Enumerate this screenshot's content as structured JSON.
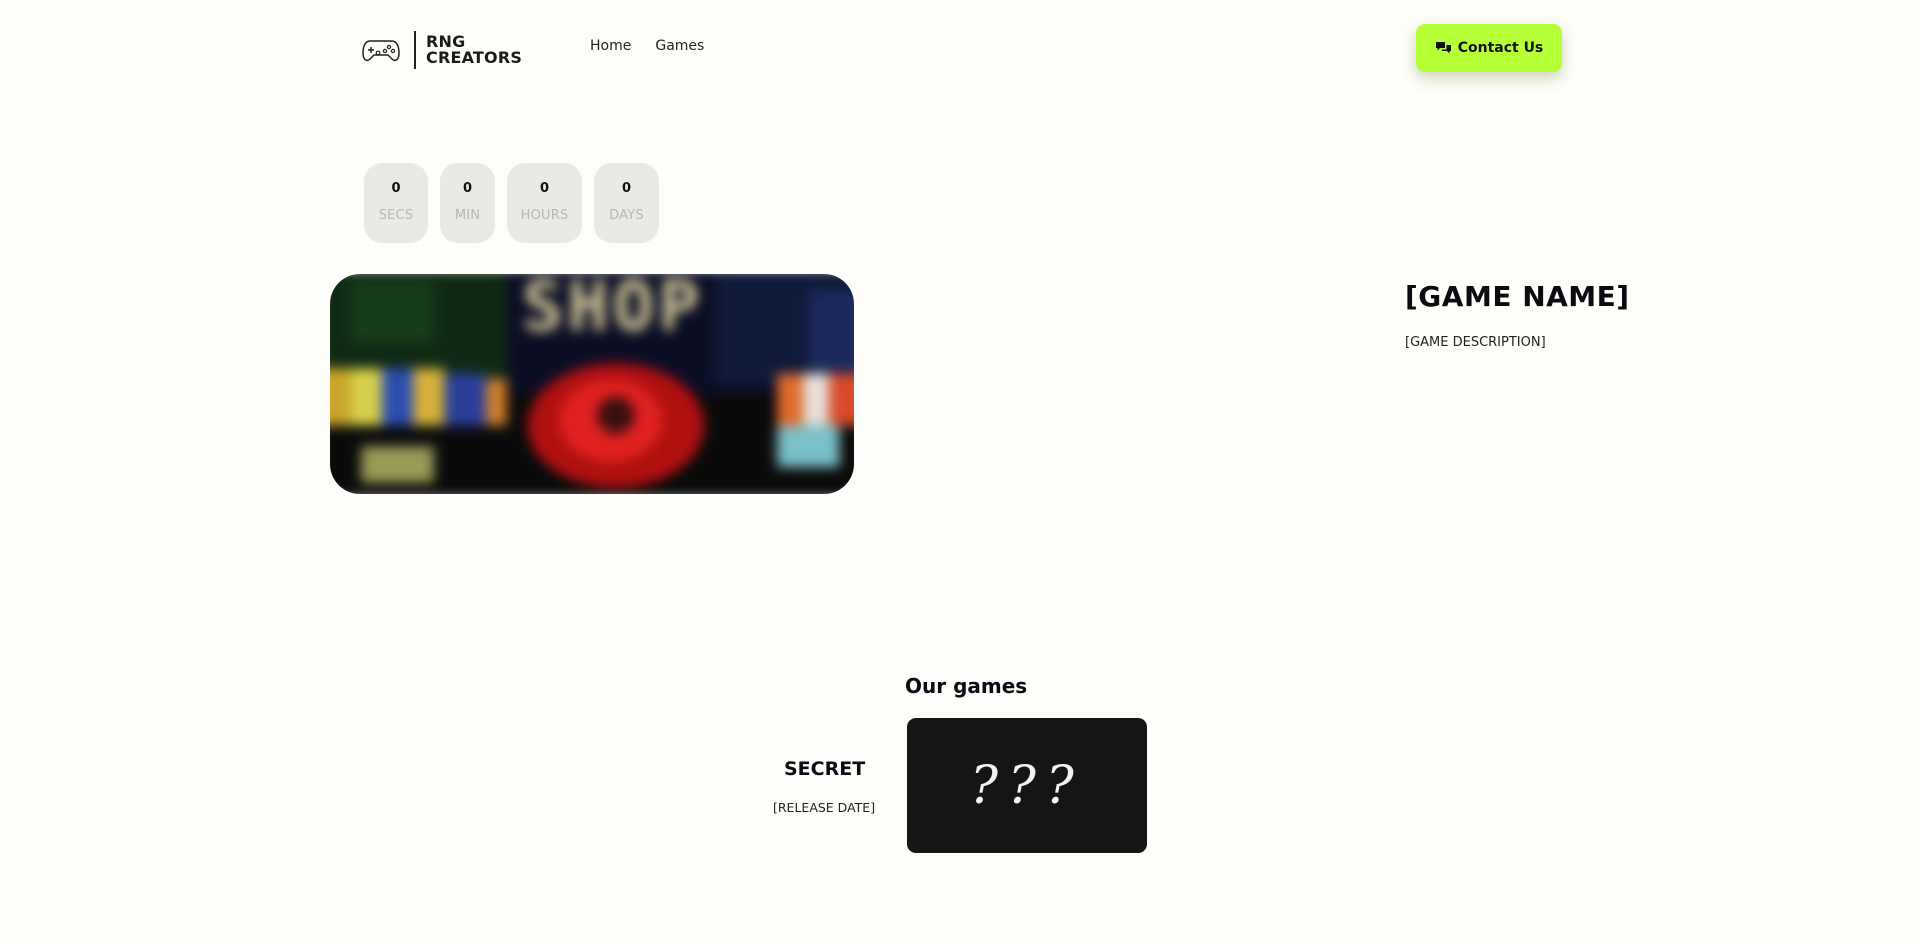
{
  "header": {
    "logo": {
      "line1": "RNG",
      "line2": "CREATORS",
      "icon": "gamepad-icon"
    },
    "nav": [
      {
        "label": "Home"
      },
      {
        "label": "Games"
      }
    ],
    "contact_button": {
      "label": "Contact Us",
      "icon": "chat-bubbles-icon"
    },
    "accent_color": "#b4ff35"
  },
  "countdown": [
    {
      "value": "0",
      "label": "SECS"
    },
    {
      "value": "0",
      "label": "MIN"
    },
    {
      "value": "0",
      "label": "HOURS"
    },
    {
      "value": "0",
      "label": "DAYS"
    }
  ],
  "featured": {
    "image_text": "SHOP",
    "game_name": "[GAME NAME]",
    "game_description": "[GAME DESCRIPTION]"
  },
  "our_games": {
    "heading": "Our games",
    "items": [
      {
        "title": "SECRET",
        "release": "[RELEASE DATE]",
        "card_text": "???"
      }
    ]
  }
}
